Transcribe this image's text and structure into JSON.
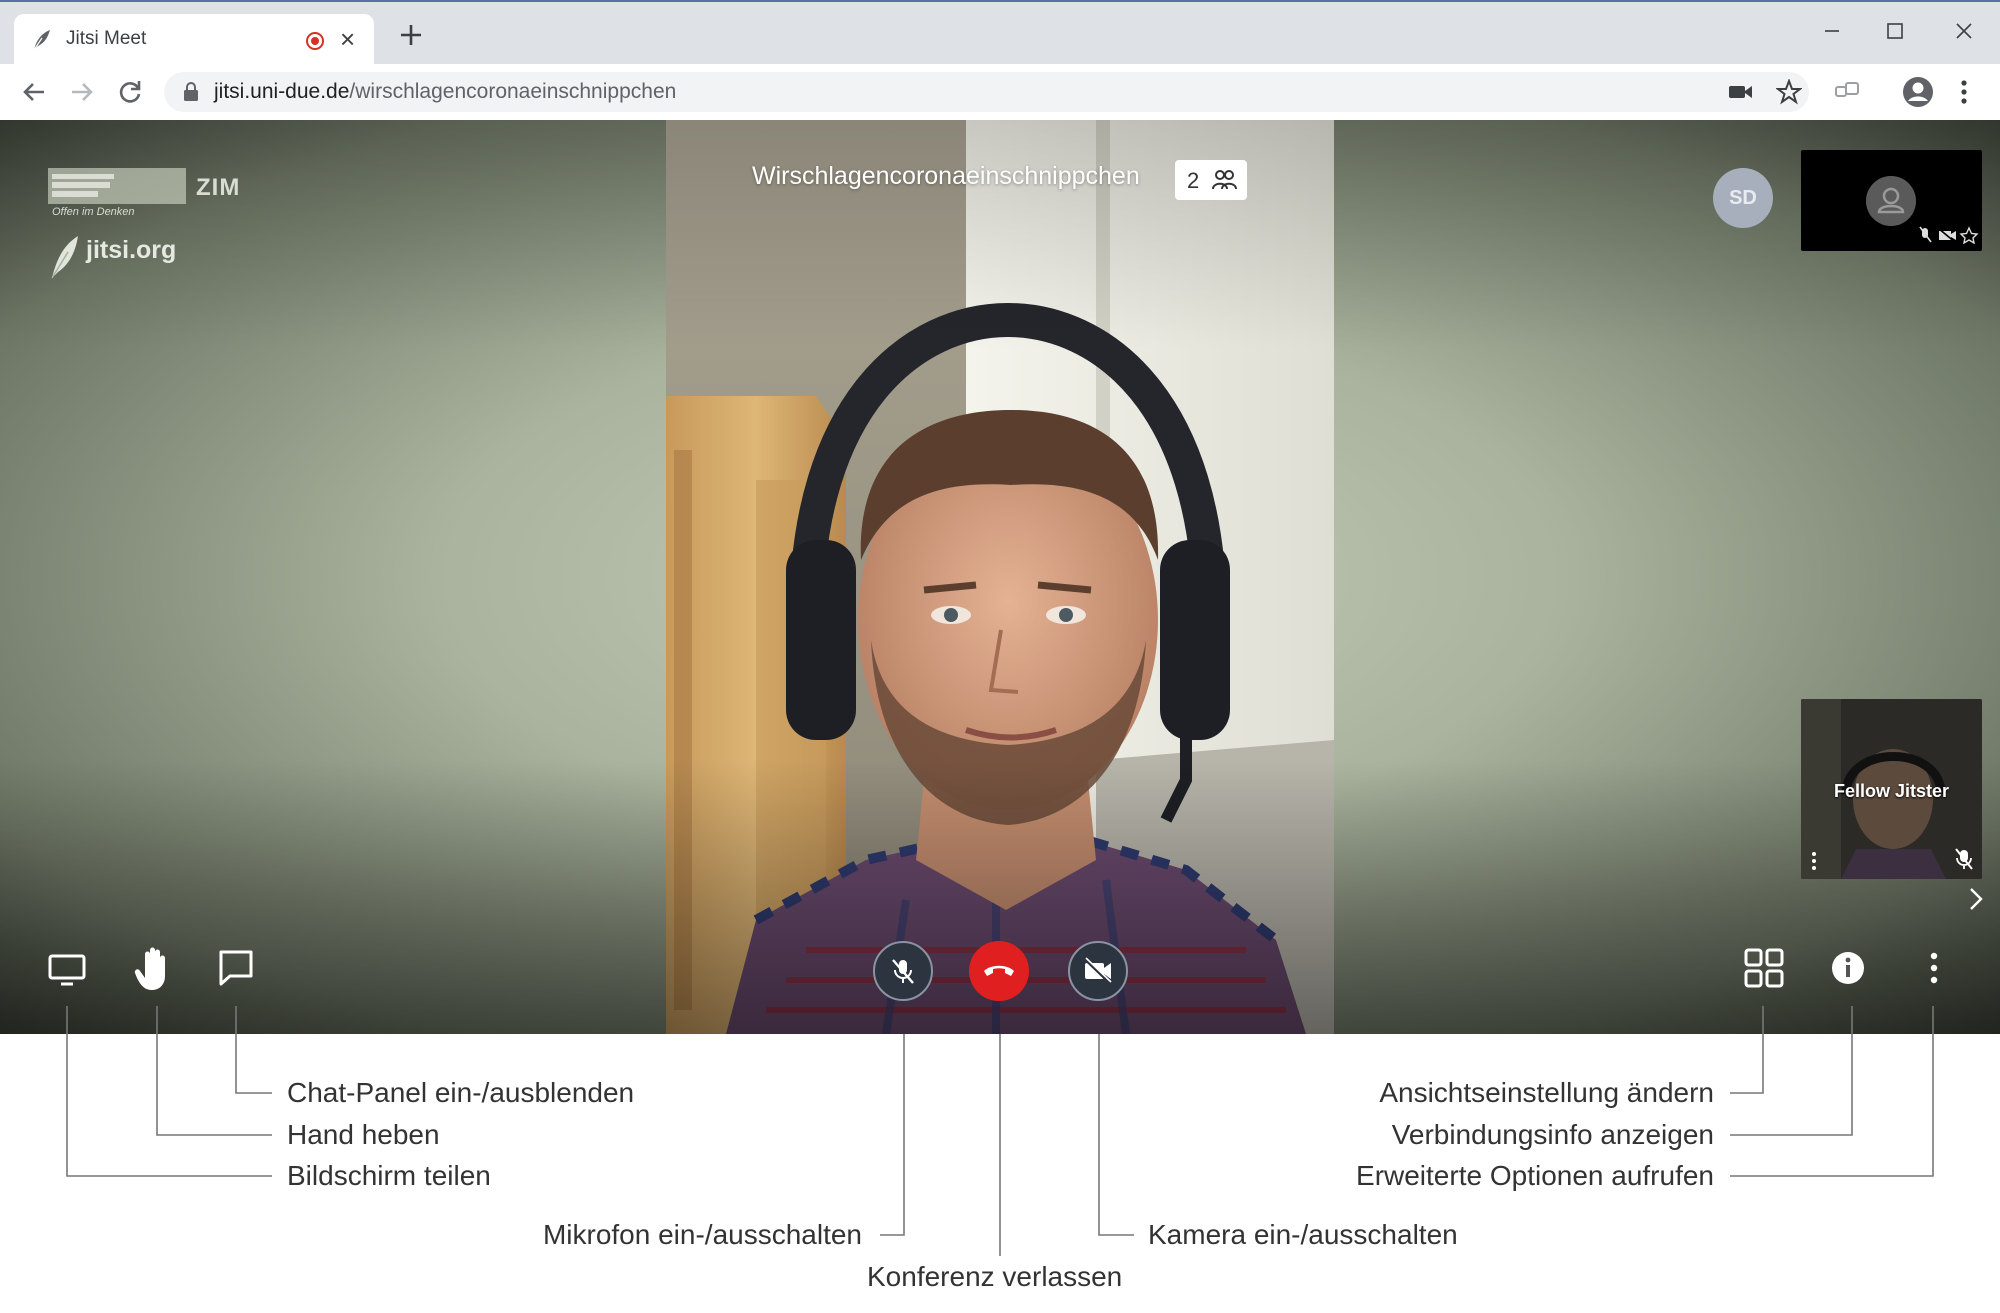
{
  "browser": {
    "tab_title": "Jitsi Meet",
    "tab_close": "×",
    "url_host": "jitsi.uni-due.de",
    "url_path": "/wirschlagencoronaeinschnippchen"
  },
  "meeting": {
    "brand_tagline": "Offen im Denken",
    "zim_logo": "ZIM",
    "watermark": "jitsi.org",
    "room_name": "Wirschlagencoronaeinschnippchen",
    "participant_count": "2",
    "remote_avatar_initials": "SD",
    "local_thumbnail_name": "Fellow Jitster"
  },
  "annotations": {
    "chat": "Chat-Panel ein-/ausblenden",
    "hand": "Hand heben",
    "screen": "Bildschirm teilen",
    "mic": "Mikrofon ein-/ausschalten",
    "hangup": "Konferenz verlassen",
    "camera": "Kamera ein-/ausschalten",
    "tileview": "Ansichtseinstellung ändern",
    "info": "Verbindungsinfo anzeigen",
    "more": "Erweiterte Optionen aufrufen"
  },
  "colors": {
    "hangup_red": "#e02020",
    "toolbar_circle": "#2c3440",
    "chrome_tabstrip": "#dee1e6"
  }
}
